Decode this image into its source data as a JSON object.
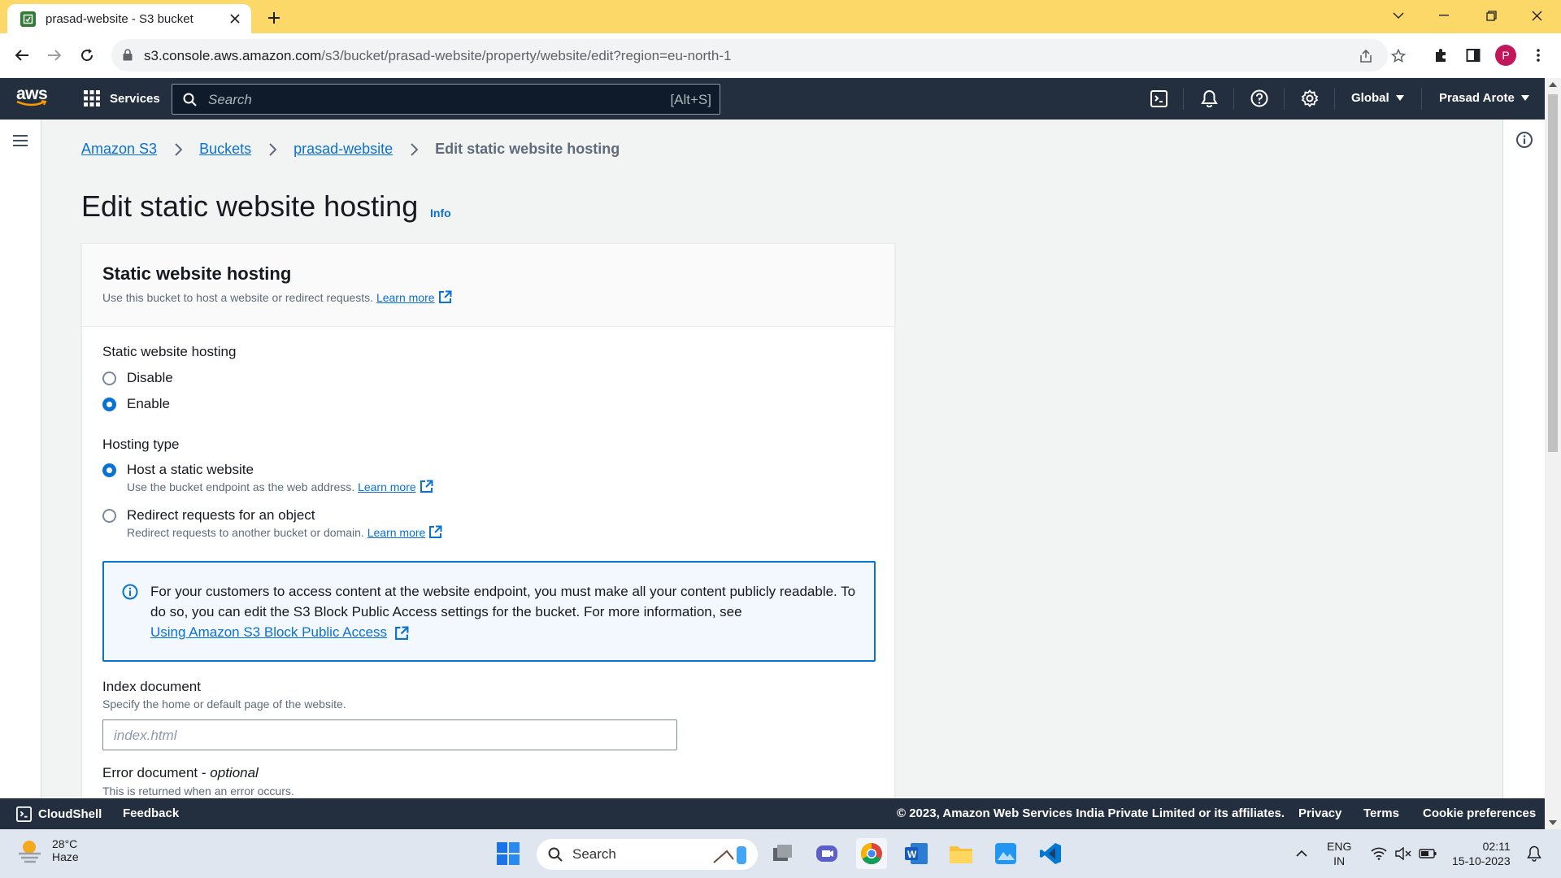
{
  "browser": {
    "tab_title": "prasad-website - S3 bucket",
    "url_host": "s3.console.aws.amazon.com",
    "url_path": "/s3/bucket/prasad-website/property/website/edit?region=eu-north-1",
    "profile_initial": "P",
    "accent": "#fcd868"
  },
  "aws_header": {
    "logo": "aws",
    "services_label": "Services",
    "search_placeholder": "Search",
    "search_shortcut": "[Alt+S]",
    "region_label": "Global",
    "account_label": "Prasad Arote"
  },
  "breadcrumb": {
    "items": [
      "Amazon S3",
      "Buckets",
      "prasad-website"
    ],
    "current": "Edit static website hosting"
  },
  "page": {
    "title": "Edit static website hosting",
    "info_label": "Info"
  },
  "panel": {
    "title": "Static website hosting",
    "description": "Use this bucket to host a website or redirect requests.",
    "learn_more": "Learn more",
    "hosting_label": "Static website hosting",
    "hosting_options": [
      {
        "label": "Disable",
        "selected": false
      },
      {
        "label": "Enable",
        "selected": true
      }
    ],
    "hosting_type_label": "Hosting type",
    "hosting_types": [
      {
        "label": "Host a static website",
        "description": "Use the bucket endpoint as the web address.",
        "learn_more": "Learn more",
        "selected": true
      },
      {
        "label": "Redirect requests for an object",
        "description": "Redirect requests to another bucket or domain.",
        "learn_more": "Learn more",
        "selected": false
      }
    ],
    "alert_text": "For your customers to access content at the website endpoint, you must make all your content publicly readable. To do so, you can edit the S3 Block Public Access settings for the bucket. For more information, see",
    "alert_link": "Using Amazon S3 Block Public Access",
    "index_label": "Index document",
    "index_description": "Specify the home or default page of the website.",
    "index_placeholder": "index.html",
    "error_label": "Error document",
    "error_optional": "optional",
    "error_separator": " - ",
    "error_description": "This is returned when an error occurs."
  },
  "footer": {
    "cloudshell": "CloudShell",
    "feedback": "Feedback",
    "copyright": "© 2023, Amazon Web Services India Private Limited or its affiliates.",
    "privacy": "Privacy",
    "terms": "Terms",
    "cookies": "Cookie preferences"
  },
  "taskbar": {
    "temperature": "28°C",
    "weather": "Haze",
    "search": "Search",
    "lang_top": "ENG",
    "lang_bottom": "IN",
    "time": "02:11",
    "date": "15-10-2023"
  },
  "colors": {
    "aws_nav": "#232f3e",
    "link": "#0972d3",
    "alert_bg": "#f2f8fd"
  }
}
